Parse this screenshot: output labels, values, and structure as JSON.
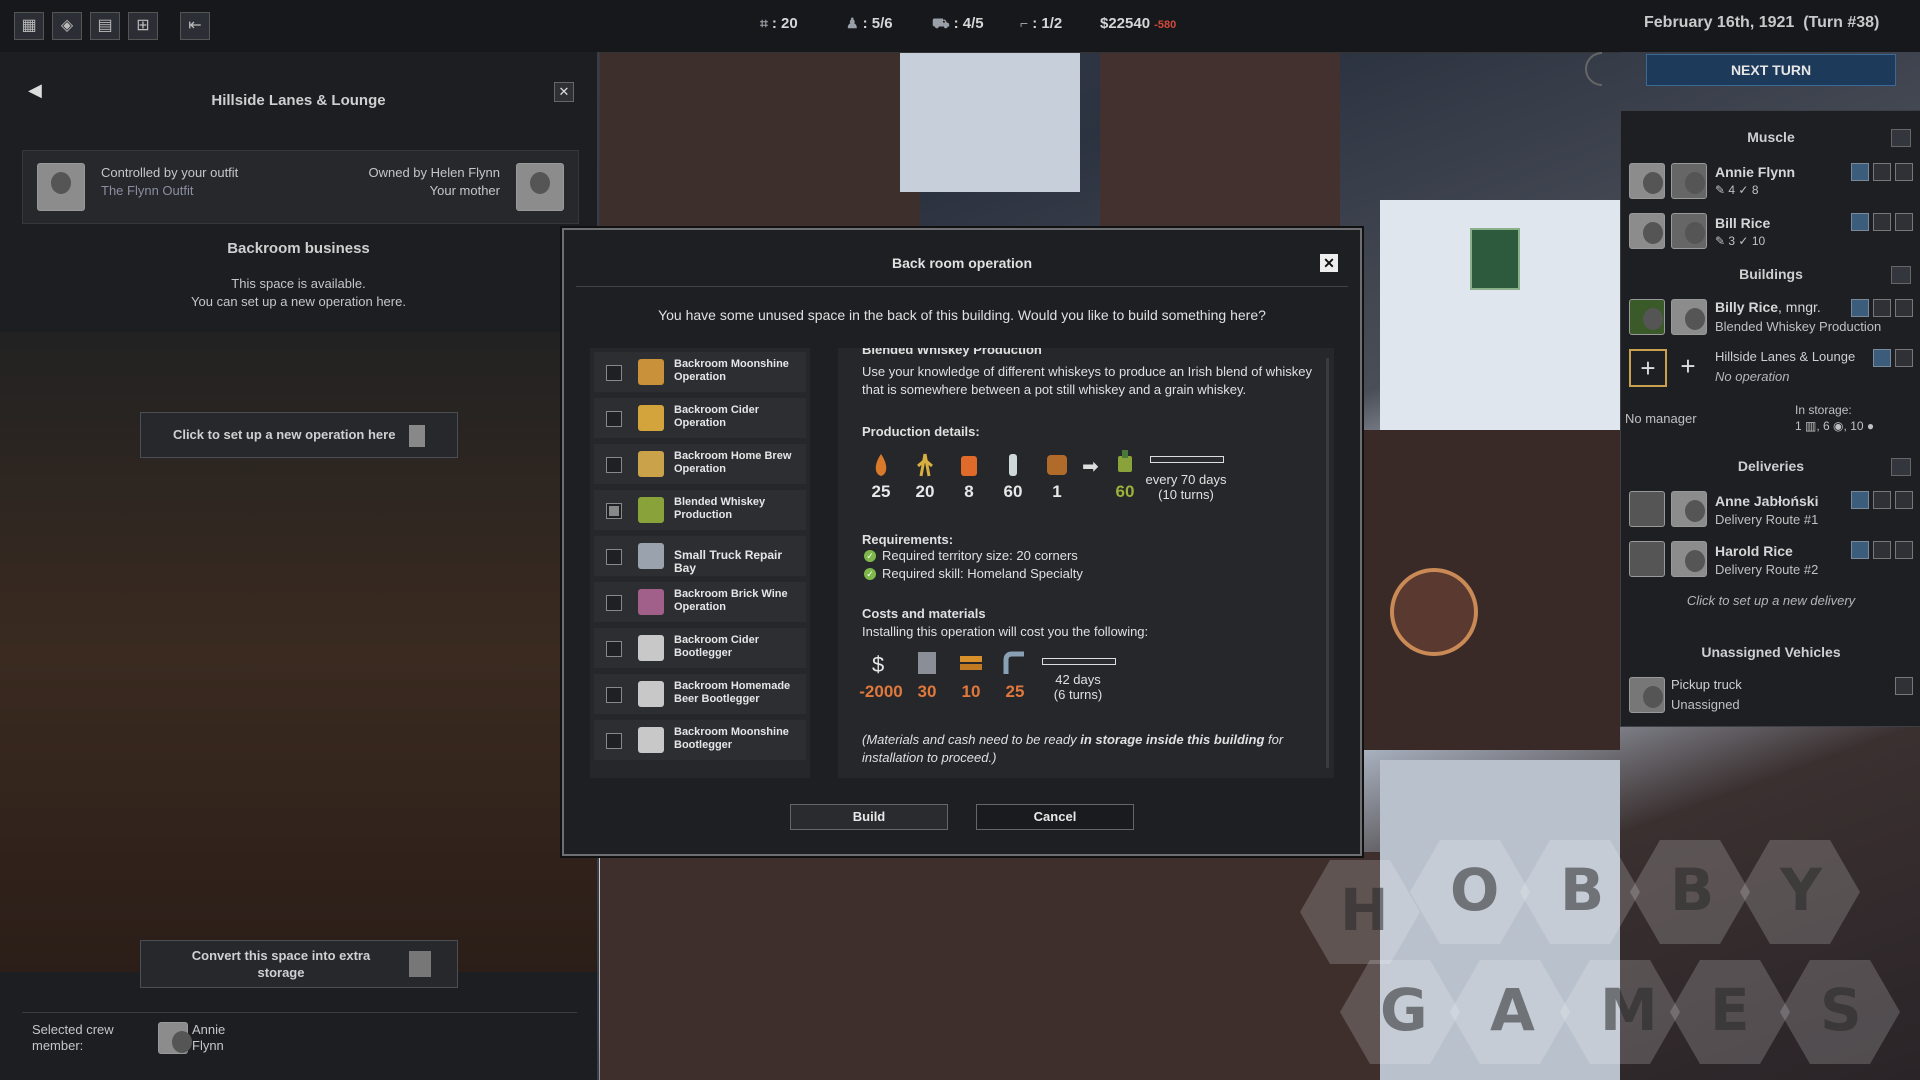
{
  "topbar": {
    "icons": [
      "map-icon",
      "territory-icon",
      "ledger-icon",
      "buildings-icon",
      "exit-icon"
    ],
    "stats": [
      {
        "icon": "corner-icon",
        "value": ": 20"
      },
      {
        "icon": "crew-icon",
        "value": ": 5/6"
      },
      {
        "icon": "truck-icon",
        "value": ": 4/5"
      },
      {
        "icon": "gun-icon",
        "value": ": 1/2"
      }
    ],
    "money": "$22540",
    "money_delta": "-580"
  },
  "date": "February 16th, 1921  (Turn #38)",
  "next_turn": "NEXT TURN",
  "left_panel": {
    "title": "Hillside Lanes & Lounge",
    "controlled_by": "Controlled by your outfit",
    "outfit": "The Flynn Outfit",
    "owned_by": "Owned by Helen Flynn",
    "owner_relation": "Your mother",
    "section_title": "Backroom business",
    "available_line1": "This space is available.",
    "available_line2": "You can set up a new operation here.",
    "setup_button": "Click to set up a new operation here",
    "convert_line1": "Convert this space into extra",
    "convert_line2": "storage",
    "selected_crew_label1": "Selected crew",
    "selected_crew_label2": "member:",
    "selected_crew_first": "Annie",
    "selected_crew_last": "Flynn"
  },
  "right_panel": {
    "muscle_title": "Muscle",
    "muscle": [
      {
        "name": "Annie Flynn",
        "stat1": "4",
        "stat2": "8"
      },
      {
        "name": "Bill Rice",
        "stat1": "3",
        "stat2": "10"
      }
    ],
    "buildings_title": "Buildings",
    "buildings": [
      {
        "name": "Billy Rice",
        "suffix": ", mngr.",
        "op": "Blended Whiskey Production"
      },
      {
        "name": "Hillside Lanes & Lounge",
        "op": "No operation"
      }
    ],
    "no_manager": "No manager",
    "in_storage_label": "In storage:",
    "in_storage_values": [
      "1",
      "6",
      "10"
    ],
    "deliveries_title": "Deliveries",
    "deliveries": [
      {
        "name": "Anne Jabłoński",
        "route": "Delivery Route #1"
      },
      {
        "name": "Harold Rice",
        "route": "Delivery Route #2"
      }
    ],
    "new_delivery": "Click to set up a new delivery",
    "vehicles_title": "Unassigned Vehicles",
    "vehicle_name": "Pickup truck",
    "vehicle_status": "Unassigned"
  },
  "modal": {
    "title": "Back room operation",
    "prompt": "You have some unused space in the back of this building. Would you like to build something here?",
    "operations": [
      {
        "line1": "Backroom Moonshine",
        "line2": "Operation",
        "checked": false,
        "color": "#c8913a"
      },
      {
        "line1": "Backroom Cider",
        "line2": "Operation",
        "checked": false,
        "color": "#d3a43c"
      },
      {
        "line1": "Backroom Home Brew",
        "line2": "Operation",
        "checked": false,
        "color": "#caa24a"
      },
      {
        "line1": "Blended Whiskey",
        "line2": "Production",
        "checked": true,
        "color": "#8aa23a"
      },
      {
        "line1": "Small Truck Repair Bay",
        "line2": "",
        "checked": false,
        "color": "#9aa3ad"
      },
      {
        "line1": "Backroom Brick Wine",
        "line2": "Operation",
        "checked": false,
        "color": "#a0608a"
      },
      {
        "line1": "Backroom Cider",
        "line2": "Bootlegger",
        "checked": false,
        "color": "#c8c8c8"
      },
      {
        "line1": "Backroom Homemade",
        "line2": "Beer Bootlegger",
        "checked": false,
        "color": "#c8c8c8"
      },
      {
        "line1": "Backroom Moonshine",
        "line2": "Bootlegger",
        "checked": false,
        "color": "#c8c8c8"
      }
    ],
    "detail": {
      "heading": "Blended Whiskey Production",
      "desc1": "Use your knowledge of different whiskeys to produce an Irish blend of whiskey",
      "desc2": "that is somewhere between a pot still whiskey and a grain whiskey.",
      "production_title": "Production details:",
      "inputs": [
        "25",
        "20",
        "8",
        "60",
        "1"
      ],
      "output": "60",
      "cycle_line1": "every 70 days",
      "cycle_line2": "(10 turns)",
      "req_title": "Requirements:",
      "req1": "Required territory size: 20 corners",
      "req2": "Required skill: Homeland Specialty",
      "costs_title": "Costs and materials",
      "costs_desc": "Installing this operation will cost you the following:",
      "costs": [
        "-2000",
        "30",
        "10",
        "25"
      ],
      "build_time1": "42 days",
      "build_time2": "(6 turns)",
      "note_pre": "(Materials and cash need to be ready ",
      "note_bold": "in storage inside this building",
      "note_post": " for",
      "note_line2": "installation to proceed.)"
    },
    "build": "Build",
    "cancel": "Cancel"
  },
  "watermark": [
    "H",
    "O",
    "B",
    "B",
    "Y",
    "G",
    "A",
    "M",
    "E",
    "S"
  ]
}
